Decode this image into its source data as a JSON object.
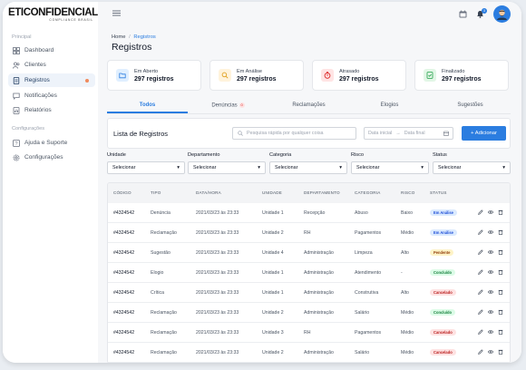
{
  "brand": {
    "name": "ETICONFIDENCIAL",
    "tagline": "COMPLIANCE BRASIL"
  },
  "sidebar": {
    "section_main": "Principal",
    "items": [
      {
        "label": "Dashboard",
        "icon": "grid-icon"
      },
      {
        "label": "Clientes",
        "icon": "users-icon"
      },
      {
        "label": "Registros",
        "icon": "document-icon",
        "active": true
      },
      {
        "label": "Notificações",
        "icon": "chat-icon"
      },
      {
        "label": "Relatórios",
        "icon": "chart-icon"
      }
    ],
    "section_config": "Configurações",
    "config_items": [
      {
        "label": "Ajuda e Suporte",
        "icon": "help-icon"
      },
      {
        "label": "Configurações",
        "icon": "gear-icon"
      }
    ]
  },
  "topbar": {
    "notification_count": "3"
  },
  "breadcrumb": {
    "home": "Home",
    "separator": "/",
    "current": "Registros"
  },
  "page": {
    "title": "Registros"
  },
  "stats": [
    {
      "label": "Em Aberto",
      "value": "297 registros",
      "color": "#e0efff",
      "icon_color": "#2b7de0"
    },
    {
      "label": "Em Análise",
      "value": "297 registros",
      "color": "#fff3dc",
      "icon_color": "#e0a020"
    },
    {
      "label": "Atrasado",
      "value": "297 registros",
      "color": "#ffe4e4",
      "icon_color": "#dc2626"
    },
    {
      "label": "Finalizado",
      "value": "297 registros",
      "color": "#e2f6e6",
      "icon_color": "#22a04a"
    }
  ],
  "tabs": [
    {
      "label": "Todos",
      "active": true
    },
    {
      "label": "Denúncias",
      "count": "0"
    },
    {
      "label": "Reclamações"
    },
    {
      "label": "Elogios"
    },
    {
      "label": "Sugestões"
    }
  ],
  "list": {
    "title": "Lista de Registros",
    "search_placeholder": "Pesquisa rápida por qualquer coisa",
    "date_start": "Data inicial",
    "date_arrow": "→",
    "date_end": "Data final",
    "add_button": "+ Adicionar"
  },
  "filters": [
    {
      "label": "Unidade",
      "value": "Selecionar"
    },
    {
      "label": "Departamento",
      "value": "Selecionar"
    },
    {
      "label": "Categoria",
      "value": "Selecionar"
    },
    {
      "label": "Risco",
      "value": "Selecionar"
    },
    {
      "label": "Status",
      "value": "Selecionar"
    }
  ],
  "table": {
    "headers": [
      "CÓDIGO",
      "TIPO",
      "DATA/HORA",
      "UNIDADE",
      "DEPARTAMENTO",
      "CATEGORIA",
      "RISCO",
      "STATUS"
    ],
    "rows": [
      {
        "code": "#4324542",
        "type": "Denúncia",
        "date": "2021/03/23 às 23:33",
        "unit": "Unidade 1",
        "dept": "Recepção",
        "cat": "Abuso",
        "risk": "Baixo",
        "status": "Em Análise",
        "kind": "em"
      },
      {
        "code": "#4324542",
        "type": "Reclamação",
        "date": "2021/03/23 às 23:33",
        "unit": "Unidade 2",
        "dept": "RH",
        "cat": "Pagamentos",
        "risk": "Médio",
        "status": "Em Análise",
        "kind": "em"
      },
      {
        "code": "#4324542",
        "type": "Sugestão",
        "date": "2021/03/23 às 23:33",
        "unit": "Unidade 4",
        "dept": "Administração",
        "cat": "Limpeza",
        "risk": "Alto",
        "status": "Pendente",
        "kind": "pend"
      },
      {
        "code": "#4324542",
        "type": "Elogio",
        "date": "2021/03/23 às 23:33",
        "unit": "Unidade 1",
        "dept": "Administração",
        "cat": "Atendimento",
        "risk": "-",
        "status": "Concluído",
        "kind": "conc"
      },
      {
        "code": "#4324542",
        "type": "Crítica",
        "date": "2021/03/23 às 23:33",
        "unit": "Unidade 1",
        "dept": "Administração",
        "cat": "Construtiva",
        "risk": "Alto",
        "status": "Cancelado",
        "kind": "canc"
      },
      {
        "code": "#4324542",
        "type": "Reclamação",
        "date": "2021/03/23 às 23:33",
        "unit": "Unidade 2",
        "dept": "Administração",
        "cat": "Salário",
        "risk": "Médio",
        "status": "Concluído",
        "kind": "conc"
      },
      {
        "code": "#4324542",
        "type": "Reclamação",
        "date": "2021/03/23 às 23:33",
        "unit": "Unidade 3",
        "dept": "RH",
        "cat": "Pagamentos",
        "risk": "Médio",
        "status": "Cancelado",
        "kind": "canc"
      },
      {
        "code": "#4324542",
        "type": "Reclamação",
        "date": "2021/03/23 às 23:33",
        "unit": "Unidade 2",
        "dept": "Administração",
        "cat": "Salário",
        "risk": "Médio",
        "status": "Cancelado",
        "kind": "canc"
      }
    ]
  }
}
